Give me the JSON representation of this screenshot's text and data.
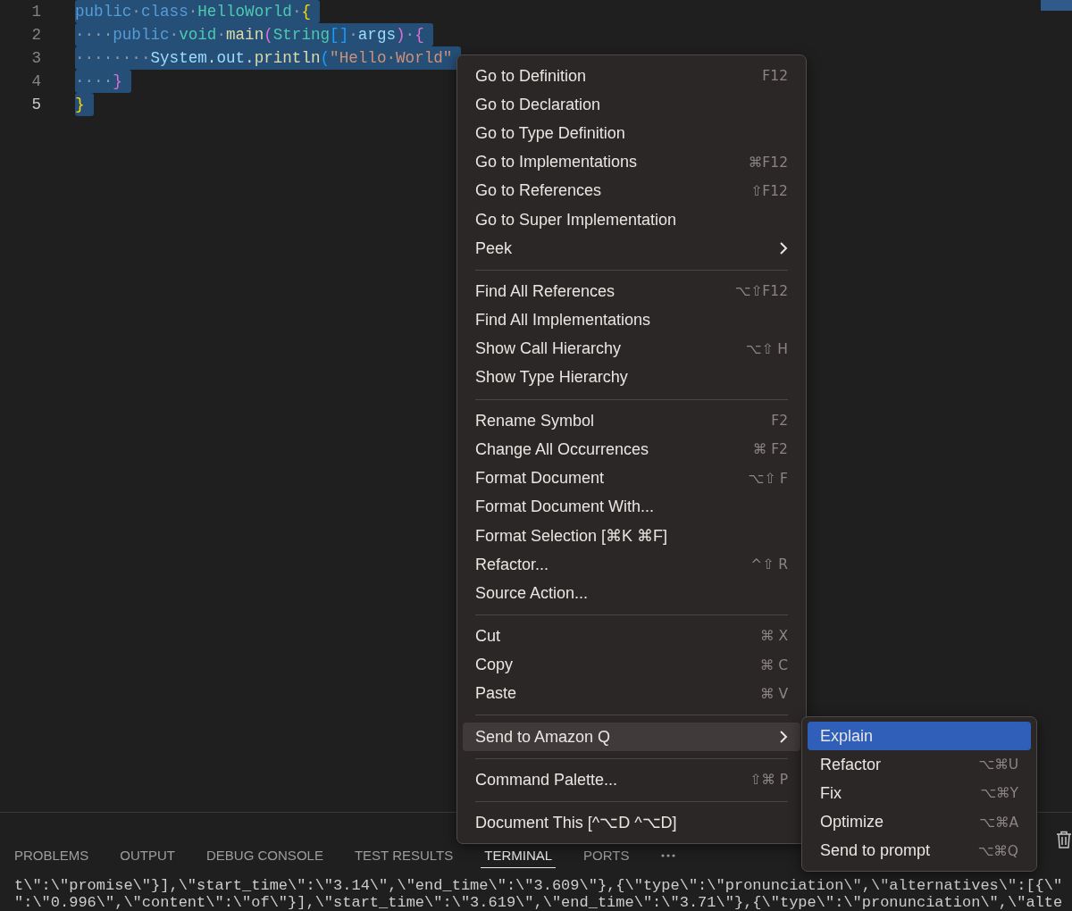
{
  "editor": {
    "lines": [
      {
        "number": "1",
        "current": false,
        "selected": true,
        "tokens": [
          {
            "text": "public",
            "kind": "keyword"
          },
          {
            "text": "·",
            "kind": "space"
          },
          {
            "text": "class",
            "kind": "keyword"
          },
          {
            "text": "·",
            "kind": "space"
          },
          {
            "text": "HelloWorld",
            "kind": "type"
          },
          {
            "text": "·",
            "kind": "space"
          },
          {
            "text": "{",
            "kind": "brace1"
          }
        ]
      },
      {
        "number": "2",
        "current": false,
        "selected": true,
        "tokens": [
          {
            "text": "····",
            "kind": "space"
          },
          {
            "text": "public",
            "kind": "keyword"
          },
          {
            "text": "·",
            "kind": "space"
          },
          {
            "text": "void",
            "kind": "type"
          },
          {
            "text": "·",
            "kind": "space"
          },
          {
            "text": "main",
            "kind": "method"
          },
          {
            "text": "(",
            "kind": "brace2"
          },
          {
            "text": "String",
            "kind": "type"
          },
          {
            "text": "[]",
            "kind": "brace3"
          },
          {
            "text": "·",
            "kind": "space"
          },
          {
            "text": "args",
            "kind": "variable"
          },
          {
            "text": ")",
            "kind": "brace2"
          },
          {
            "text": "·",
            "kind": "space"
          },
          {
            "text": "{",
            "kind": "brace2"
          }
        ]
      },
      {
        "number": "3",
        "current": false,
        "selected": true,
        "tokens": [
          {
            "text": "········",
            "kind": "space"
          },
          {
            "text": "System",
            "kind": "variable"
          },
          {
            "text": ".",
            "kind": "plain"
          },
          {
            "text": "out",
            "kind": "variable"
          },
          {
            "text": ".",
            "kind": "plain"
          },
          {
            "text": "println",
            "kind": "method"
          },
          {
            "text": "(",
            "kind": "brace3"
          },
          {
            "text": "\"Hello·World\"",
            "kind": "string"
          }
        ]
      },
      {
        "number": "4",
        "current": false,
        "selected": true,
        "tokens": [
          {
            "text": "····",
            "kind": "space"
          },
          {
            "text": "}",
            "kind": "brace2"
          }
        ]
      },
      {
        "number": "5",
        "current": true,
        "selected": true,
        "tokens": [
          {
            "text": "}",
            "kind": "brace1"
          }
        ]
      }
    ]
  },
  "context_menu": {
    "items": [
      {
        "kind": "item",
        "label": "Go to Definition",
        "shortcut": "F12",
        "has_submenu": false,
        "selected": false
      },
      {
        "kind": "item",
        "label": "Go to Declaration",
        "has_submenu": false,
        "selected": false
      },
      {
        "kind": "item",
        "label": "Go to Type Definition",
        "has_submenu": false,
        "selected": false
      },
      {
        "kind": "item",
        "label": "Go to Implementations",
        "shortcut": "⌘F12",
        "has_submenu": false,
        "selected": false
      },
      {
        "kind": "item",
        "label": "Go to References",
        "shortcut": "⇧F12",
        "has_submenu": false,
        "selected": false
      },
      {
        "kind": "item",
        "label": "Go to Super Implementation",
        "has_submenu": false,
        "selected": false
      },
      {
        "kind": "item",
        "label": "Peek",
        "has_submenu": true,
        "selected": false
      },
      {
        "kind": "separator"
      },
      {
        "kind": "item",
        "label": "Find All References",
        "shortcut": "⌥⇧F12",
        "has_submenu": false,
        "selected": false
      },
      {
        "kind": "item",
        "label": "Find All Implementations",
        "has_submenu": false,
        "selected": false
      },
      {
        "kind": "item",
        "label": "Show Call Hierarchy",
        "shortcut": "⌥⇧ H",
        "has_submenu": false,
        "selected": false
      },
      {
        "kind": "item",
        "label": "Show Type Hierarchy",
        "has_submenu": false,
        "selected": false
      },
      {
        "kind": "separator"
      },
      {
        "kind": "item",
        "label": "Rename Symbol",
        "shortcut": "F2",
        "has_submenu": false,
        "selected": false
      },
      {
        "kind": "item",
        "label": "Change All Occurrences",
        "shortcut": "⌘ F2",
        "has_submenu": false,
        "selected": false
      },
      {
        "kind": "item",
        "label": "Format Document",
        "shortcut": "⌥⇧ F",
        "has_submenu": false,
        "selected": false
      },
      {
        "kind": "item",
        "label": "Format Document With...",
        "has_submenu": false,
        "selected": false
      },
      {
        "kind": "item",
        "label": "Format Selection [⌘K ⌘F]",
        "has_submenu": false,
        "selected": false
      },
      {
        "kind": "item",
        "label": "Refactor...",
        "shortcut": "^⇧ R",
        "has_submenu": false,
        "selected": false
      },
      {
        "kind": "item",
        "label": "Source Action...",
        "has_submenu": false,
        "selected": false
      },
      {
        "kind": "separator"
      },
      {
        "kind": "item",
        "label": "Cut",
        "shortcut": "⌘ X",
        "has_submenu": false,
        "selected": false
      },
      {
        "kind": "item",
        "label": "Copy",
        "shortcut": "⌘ C",
        "has_submenu": false,
        "selected": false
      },
      {
        "kind": "item",
        "label": "Paste",
        "shortcut": "⌘ V",
        "has_submenu": false,
        "selected": false
      },
      {
        "kind": "separator"
      },
      {
        "kind": "item",
        "label": "Send to Amazon Q",
        "has_submenu": true,
        "selected": true
      },
      {
        "kind": "separator"
      },
      {
        "kind": "item",
        "label": "Command Palette...",
        "shortcut": "⇧⌘ P",
        "has_submenu": false,
        "selected": false
      },
      {
        "kind": "separator"
      },
      {
        "kind": "item",
        "label": "Document This [^⌥D ^⌥D]",
        "has_submenu": false,
        "selected": false
      }
    ]
  },
  "submenu": {
    "items": [
      {
        "kind": "item",
        "label": "Explain",
        "has_submenu": false,
        "selected": true
      },
      {
        "kind": "item",
        "label": "Refactor",
        "shortcut": "⌥⌘U",
        "has_submenu": false,
        "selected": false
      },
      {
        "kind": "item",
        "label": "Fix",
        "shortcut": "⌥⌘Y",
        "has_submenu": false,
        "selected": false
      },
      {
        "kind": "item",
        "label": "Optimize",
        "shortcut": "⌥⌘A",
        "has_submenu": false,
        "selected": false
      },
      {
        "kind": "item",
        "label": "Send to prompt",
        "shortcut": "⌥⌘Q",
        "has_submenu": false,
        "selected": false
      }
    ]
  },
  "panel": {
    "tabs": [
      {
        "label": "PROBLEMS",
        "selected": false
      },
      {
        "label": "OUTPUT",
        "selected": false
      },
      {
        "label": "DEBUG CONSOLE",
        "selected": false
      },
      {
        "label": "TEST RESULTS",
        "selected": false
      },
      {
        "label": "TERMINAL",
        "selected": true
      },
      {
        "label": "PORTS",
        "selected": false
      }
    ],
    "terminal_lines": [
      "t\\\":\\\"promise\\\"}],\\\"start_time\\\":\\\"3.14\\\",\\\"end_time\\\":\\\"3.609\\\"},{\\\"type\\\":\\\"pronunciation\\\",\\\"alternatives\\\":[{\\\"",
      "\":\\\"0.996\\\",\\\"content\\\":\\\"of\\\"}],\\\"start_time\\\":\\\"3.619\\\",\\\"end_time\\\":\\\"3.71\\\"},{\\\"type\\\":\\\"pronunciation\\\",\\\"alte"
    ]
  }
}
